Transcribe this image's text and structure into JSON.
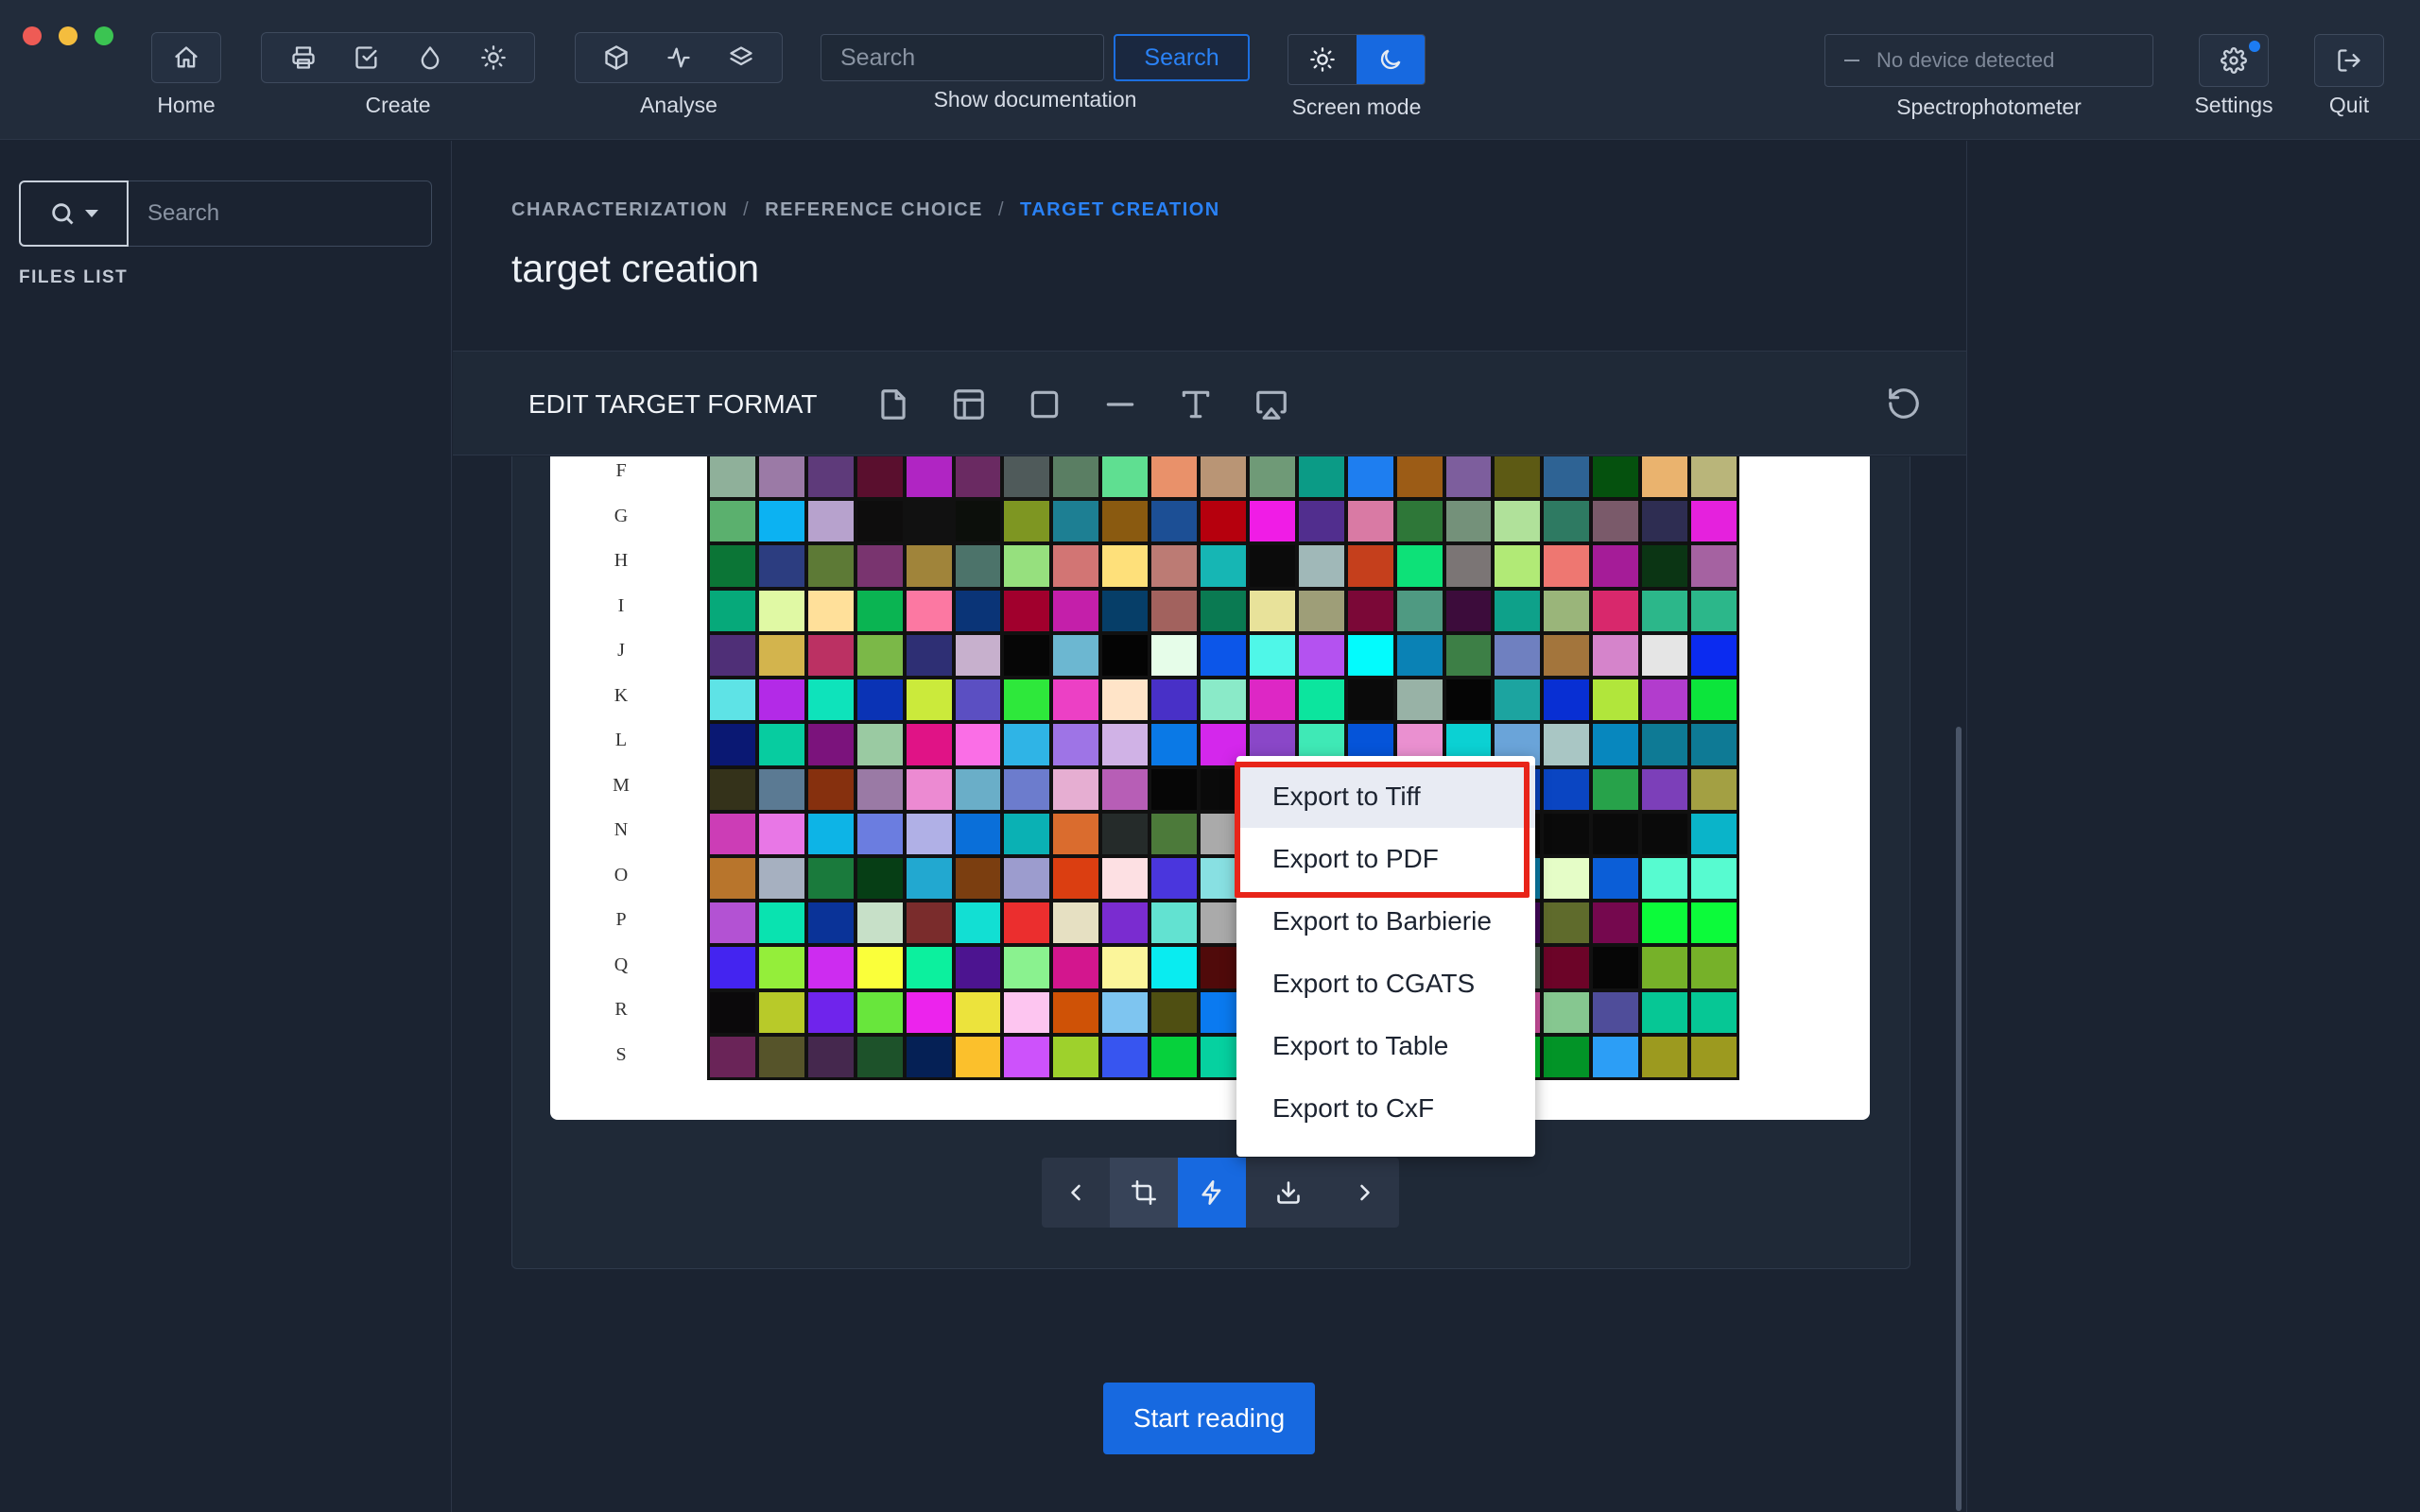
{
  "toolbar": {
    "home_label": "Home",
    "create_label": "Create",
    "analyse_label": "Analyse",
    "search_placeholder": "Search",
    "search_button": "Search",
    "show_doc_label": "Show documentation",
    "screen_mode_label": "Screen mode",
    "device_status": "No device detected",
    "spectro_label": "Spectrophotometer",
    "settings_label": "Settings",
    "quit_label": "Quit",
    "icons": {
      "home": "home-icon",
      "create": [
        "printer-icon",
        "checkbox-icon",
        "droplet-icon",
        "sun-icon"
      ],
      "analyse": [
        "cube-icon",
        "activity-icon",
        "layers-icon"
      ],
      "screen_mode": [
        "sun-icon",
        "moon-icon"
      ],
      "settings": "gear-icon",
      "quit": "logout-icon"
    },
    "active_screen_mode": "dark"
  },
  "sidebar": {
    "search_placeholder": "Search",
    "files_label": "FILES LIST"
  },
  "main": {
    "breadcrumb": [
      "CHARACTERIZATION",
      "REFERENCE CHOICE",
      "TARGET CREATION"
    ],
    "title": "target creation",
    "edit_title": "EDIT TARGET FORMAT",
    "row_labels": [
      "F",
      "G",
      "H",
      "I",
      "J",
      "K",
      "L",
      "M",
      "N",
      "O",
      "P",
      "Q",
      "R",
      "S"
    ],
    "start_button": "Start reading"
  },
  "context_menu": {
    "items": [
      "Export to Tiff",
      "Export to PDF",
      "Export to Barbierie",
      "Export to CGATS",
      "Export to Table",
      "Export to CxF"
    ]
  },
  "colors": {
    "accent": "#1769e0",
    "highlight": "#e82419",
    "background": "#1b2331"
  }
}
